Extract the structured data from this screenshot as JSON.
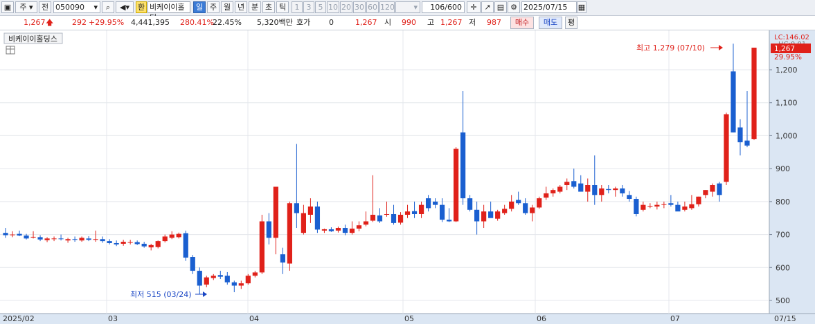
{
  "toolbar": {
    "market": "주",
    "prev_label": "전",
    "code": "050090",
    "hwan": "환",
    "stock_name": "비케이이홀딩",
    "periods": [
      "일",
      "주",
      "월",
      "년",
      "분",
      "초",
      "틱"
    ],
    "minutes": [
      "1",
      "3",
      "5",
      "10",
      "20",
      "30",
      "60",
      "120"
    ],
    "count": "106",
    "count_max": "/600",
    "date": "2025/07/15"
  },
  "quote": {
    "price": "1,267",
    "change": "292",
    "change_pct": "+29.95%",
    "volume": "4,441,395",
    "volume_ratio": "280.41%",
    "turnover": "22.45%",
    "amount": "5,320백만",
    "hoga_label": "호가",
    "hoga_value": "0",
    "hoga_price": "1,267",
    "open_label": "시",
    "open": "990",
    "high_label": "고",
    "high": "1,267",
    "low_label": "저",
    "low": "987",
    "buy_button": "매수",
    "sell_button": "매도",
    "eval_button": "평"
  },
  "chart_title": "비케이이홀딩스",
  "annotations": {
    "high": "최고 1,279 (07/10)",
    "low": "최저 515 (03/24)"
  },
  "price_tags": {
    "lc": "LC:146.02",
    "hc": "HC:0.01",
    "last": "1,267",
    "pct": "29.95%"
  },
  "colors": {
    "up": "#e0211a",
    "down": "#1a5fd0",
    "axis_bg": "#dbe6f3"
  },
  "chart_data": {
    "type": "candlestick",
    "title": "비케이이홀딩스",
    "x_labels": [
      "2025/02",
      "03",
      "04",
      "05",
      "06",
      "07",
      "07/15"
    ],
    "y_ticks": [
      500,
      600,
      700,
      800,
      900,
      1000,
      1100,
      1200
    ],
    "ylim": [
      480,
      1300
    ],
    "grid": true,
    "candles": [
      {
        "o": 705,
        "h": 720,
        "l": 690,
        "c": 698
      },
      {
        "o": 698,
        "h": 710,
        "l": 692,
        "c": 700
      },
      {
        "o": 702,
        "h": 712,
        "l": 695,
        "c": 697
      },
      {
        "o": 697,
        "h": 702,
        "l": 685,
        "c": 688
      },
      {
        "o": 692,
        "h": 710,
        "l": 688,
        "c": 693
      },
      {
        "o": 692,
        "h": 698,
        "l": 680,
        "c": 685
      },
      {
        "o": 683,
        "h": 692,
        "l": 677,
        "c": 688
      },
      {
        "o": 686,
        "h": 694,
        "l": 680,
        "c": 688
      },
      {
        "o": 688,
        "h": 700,
        "l": 682,
        "c": 686
      },
      {
        "o": 682,
        "h": 690,
        "l": 675,
        "c": 686
      },
      {
        "o": 686,
        "h": 694,
        "l": 678,
        "c": 684
      },
      {
        "o": 682,
        "h": 694,
        "l": 678,
        "c": 690
      },
      {
        "o": 688,
        "h": 695,
        "l": 680,
        "c": 684
      },
      {
        "o": 684,
        "h": 712,
        "l": 678,
        "c": 686
      },
      {
        "o": 686,
        "h": 694,
        "l": 675,
        "c": 680
      },
      {
        "o": 680,
        "h": 686,
        "l": 670,
        "c": 674
      },
      {
        "o": 674,
        "h": 682,
        "l": 665,
        "c": 670
      },
      {
        "o": 672,
        "h": 684,
        "l": 666,
        "c": 678
      },
      {
        "o": 676,
        "h": 684,
        "l": 670,
        "c": 677
      },
      {
        "o": 677,
        "h": 682,
        "l": 668,
        "c": 671
      },
      {
        "o": 672,
        "h": 678,
        "l": 660,
        "c": 664
      },
      {
        "o": 661,
        "h": 672,
        "l": 652,
        "c": 668
      },
      {
        "o": 662,
        "h": 682,
        "l": 658,
        "c": 680
      },
      {
        "o": 680,
        "h": 700,
        "l": 676,
        "c": 694
      },
      {
        "o": 690,
        "h": 710,
        "l": 686,
        "c": 700
      },
      {
        "o": 692,
        "h": 706,
        "l": 688,
        "c": 702
      },
      {
        "o": 704,
        "h": 712,
        "l": 620,
        "c": 630
      },
      {
        "o": 632,
        "h": 638,
        "l": 580,
        "c": 590
      },
      {
        "o": 590,
        "h": 600,
        "l": 518,
        "c": 545
      },
      {
        "o": 548,
        "h": 575,
        "l": 540,
        "c": 570
      },
      {
        "o": 568,
        "h": 580,
        "l": 562,
        "c": 575
      },
      {
        "o": 577,
        "h": 590,
        "l": 565,
        "c": 572
      },
      {
        "o": 575,
        "h": 586,
        "l": 548,
        "c": 555
      },
      {
        "o": 555,
        "h": 560,
        "l": 525,
        "c": 545
      },
      {
        "o": 545,
        "h": 560,
        "l": 535,
        "c": 552
      },
      {
        "o": 552,
        "h": 580,
        "l": 548,
        "c": 575
      },
      {
        "o": 575,
        "h": 590,
        "l": 570,
        "c": 585
      },
      {
        "o": 585,
        "h": 760,
        "l": 580,
        "c": 740
      },
      {
        "o": 740,
        "h": 765,
        "l": 670,
        "c": 690
      },
      {
        "o": 690,
        "h": 790,
        "l": 640,
        "c": 845
      },
      {
        "o": 640,
        "h": 660,
        "l": 580,
        "c": 615
      },
      {
        "o": 612,
        "h": 800,
        "l": 590,
        "c": 795
      },
      {
        "o": 795,
        "h": 975,
        "l": 720,
        "c": 765
      },
      {
        "o": 705,
        "h": 790,
        "l": 700,
        "c": 765
      },
      {
        "o": 760,
        "h": 810,
        "l": 735,
        "c": 785
      },
      {
        "o": 785,
        "h": 800,
        "l": 705,
        "c": 715
      },
      {
        "o": 712,
        "h": 718,
        "l": 705,
        "c": 716
      },
      {
        "o": 716,
        "h": 722,
        "l": 708,
        "c": 710
      },
      {
        "o": 712,
        "h": 724,
        "l": 706,
        "c": 720
      },
      {
        "o": 720,
        "h": 730,
        "l": 698,
        "c": 705
      },
      {
        "o": 705,
        "h": 740,
        "l": 700,
        "c": 718
      },
      {
        "o": 718,
        "h": 740,
        "l": 710,
        "c": 728
      },
      {
        "o": 730,
        "h": 770,
        "l": 725,
        "c": 740
      },
      {
        "o": 742,
        "h": 880,
        "l": 738,
        "c": 760
      },
      {
        "o": 758,
        "h": 780,
        "l": 735,
        "c": 740
      },
      {
        "o": 762,
        "h": 800,
        "l": 754,
        "c": 762
      },
      {
        "o": 762,
        "h": 790,
        "l": 730,
        "c": 735
      },
      {
        "o": 736,
        "h": 768,
        "l": 730,
        "c": 760
      },
      {
        "o": 760,
        "h": 790,
        "l": 750,
        "c": 770
      },
      {
        "o": 771,
        "h": 800,
        "l": 750,
        "c": 762
      },
      {
        "o": 762,
        "h": 800,
        "l": 750,
        "c": 790
      },
      {
        "o": 810,
        "h": 820,
        "l": 770,
        "c": 780
      },
      {
        "o": 800,
        "h": 810,
        "l": 780,
        "c": 790
      },
      {
        "o": 790,
        "h": 810,
        "l": 738,
        "c": 745
      },
      {
        "o": 745,
        "h": 780,
        "l": 738,
        "c": 740
      },
      {
        "o": 740,
        "h": 965,
        "l": 738,
        "c": 960
      },
      {
        "o": 1010,
        "h": 1135,
        "l": 790,
        "c": 810
      },
      {
        "o": 810,
        "h": 820,
        "l": 770,
        "c": 775
      },
      {
        "o": 775,
        "h": 800,
        "l": 700,
        "c": 740
      },
      {
        "o": 740,
        "h": 790,
        "l": 720,
        "c": 770
      },
      {
        "o": 770,
        "h": 800,
        "l": 760,
        "c": 750
      },
      {
        "o": 748,
        "h": 775,
        "l": 742,
        "c": 770
      },
      {
        "o": 765,
        "h": 790,
        "l": 760,
        "c": 778
      },
      {
        "o": 778,
        "h": 820,
        "l": 770,
        "c": 800
      },
      {
        "o": 805,
        "h": 830,
        "l": 790,
        "c": 795
      },
      {
        "o": 795,
        "h": 810,
        "l": 760,
        "c": 765
      },
      {
        "o": 765,
        "h": 790,
        "l": 740,
        "c": 782
      },
      {
        "o": 782,
        "h": 815,
        "l": 778,
        "c": 810
      },
      {
        "o": 812,
        "h": 845,
        "l": 805,
        "c": 825
      },
      {
        "o": 825,
        "h": 840,
        "l": 815,
        "c": 835
      },
      {
        "o": 830,
        "h": 850,
        "l": 825,
        "c": 845
      },
      {
        "o": 850,
        "h": 870,
        "l": 835,
        "c": 860
      },
      {
        "o": 862,
        "h": 900,
        "l": 840,
        "c": 845
      },
      {
        "o": 855,
        "h": 880,
        "l": 840,
        "c": 830
      },
      {
        "o": 830,
        "h": 870,
        "l": 800,
        "c": 850
      },
      {
        "o": 850,
        "h": 940,
        "l": 790,
        "c": 820
      },
      {
        "o": 820,
        "h": 850,
        "l": 800,
        "c": 840
      },
      {
        "o": 838,
        "h": 850,
        "l": 825,
        "c": 835
      },
      {
        "o": 835,
        "h": 845,
        "l": 815,
        "c": 840
      },
      {
        "o": 840,
        "h": 850,
        "l": 815,
        "c": 825
      },
      {
        "o": 820,
        "h": 832,
        "l": 800,
        "c": 808
      },
      {
        "o": 808,
        "h": 815,
        "l": 755,
        "c": 762
      },
      {
        "o": 775,
        "h": 800,
        "l": 770,
        "c": 790
      },
      {
        "o": 785,
        "h": 795,
        "l": 780,
        "c": 787
      },
      {
        "o": 785,
        "h": 800,
        "l": 776,
        "c": 790
      },
      {
        "o": 790,
        "h": 800,
        "l": 780,
        "c": 792
      },
      {
        "o": 795,
        "h": 820,
        "l": 785,
        "c": 790
      },
      {
        "o": 790,
        "h": 800,
        "l": 775,
        "c": 770
      },
      {
        "o": 775,
        "h": 800,
        "l": 770,
        "c": 785
      },
      {
        "o": 780,
        "h": 820,
        "l": 775,
        "c": 792
      },
      {
        "o": 792,
        "h": 815,
        "l": 785,
        "c": 815
      },
      {
        "o": 820,
        "h": 835,
        "l": 810,
        "c": 835
      },
      {
        "o": 830,
        "h": 855,
        "l": 815,
        "c": 850
      },
      {
        "o": 855,
        "h": 860,
        "l": 800,
        "c": 820
      },
      {
        "o": 860,
        "h": 1070,
        "l": 850,
        "c": 1065
      },
      {
        "o": 1195,
        "h": 1279,
        "l": 1010,
        "c": 1010
      },
      {
        "o": 1025,
        "h": 1050,
        "l": 940,
        "c": 980
      },
      {
        "o": 985,
        "h": 1135,
        "l": 965,
        "c": 970
      },
      {
        "o": 990,
        "h": 1267,
        "l": 987,
        "c": 1267
      }
    ]
  }
}
